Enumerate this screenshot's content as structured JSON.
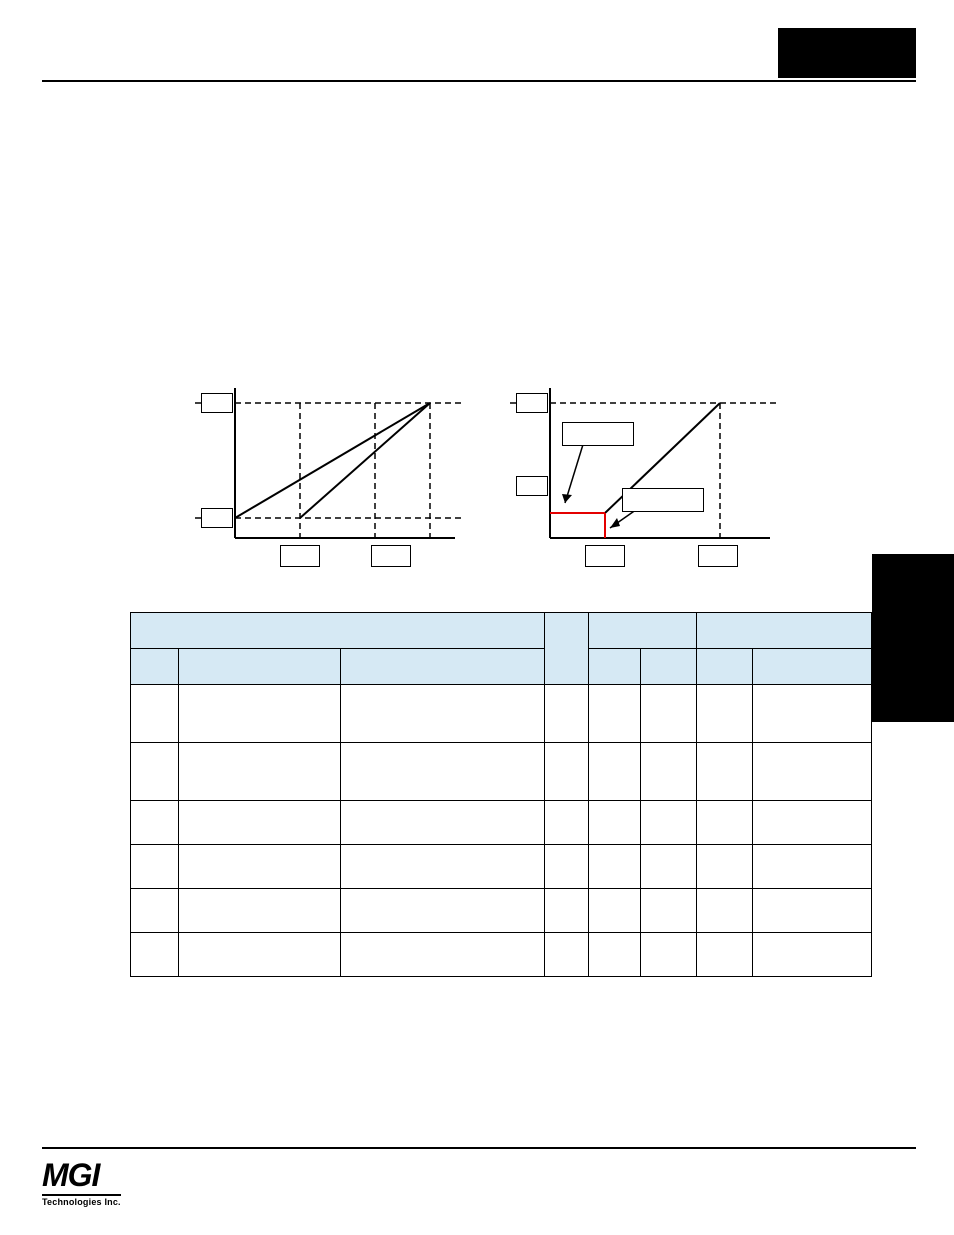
{
  "footer": {
    "brand_top": "MGI",
    "brand_bottom": "Technologies Inc."
  },
  "table": {
    "headers": {
      "parameter": "",
      "unit": "",
      "range": "",
      "set": "",
      "no": "",
      "name": "",
      "desc": "",
      "min": "",
      "def": "",
      "max": ""
    },
    "rows": [
      {
        "no": "",
        "name": "",
        "desc": "",
        "unit": "",
        "min": "",
        "def": "",
        "max": "",
        "set": ""
      },
      {
        "no": "",
        "name": "",
        "desc": "",
        "unit": "",
        "min": "",
        "def": "",
        "max": "",
        "set": ""
      },
      {
        "no": "",
        "name": "",
        "desc": "",
        "unit": "",
        "min": "",
        "def": "",
        "max": "",
        "set": ""
      },
      {
        "no": "",
        "name": "",
        "desc": "",
        "unit": "",
        "min": "",
        "def": "",
        "max": "",
        "set": ""
      },
      {
        "no": "",
        "name": "",
        "desc": "",
        "unit": "",
        "min": "",
        "def": "",
        "max": "",
        "set": ""
      },
      {
        "no": "",
        "name": "",
        "desc": "",
        "unit": "",
        "min": "",
        "def": "",
        "max": "",
        "set": ""
      }
    ]
  }
}
